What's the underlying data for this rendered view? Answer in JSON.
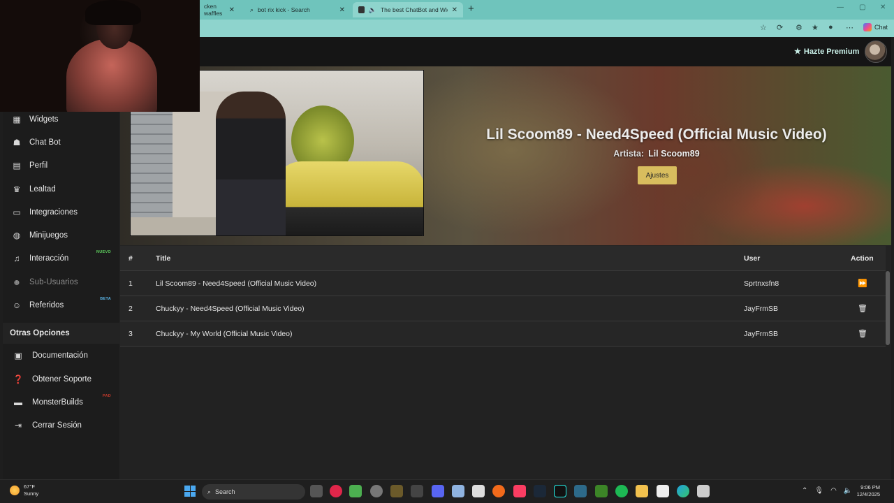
{
  "browser": {
    "tabs": [
      {
        "label": "cken waffles"
      },
      {
        "label": "bot rix kick - Search"
      },
      {
        "label": "The best ChatBot and Widge"
      }
    ],
    "new_tab": "+",
    "chat_label": "Chat"
  },
  "header": {
    "premium_label": "Hazte Premium"
  },
  "sidebar": {
    "items": [
      {
        "label": "Widgets",
        "icon": "widgets-icon"
      },
      {
        "label": "Chat Bot",
        "icon": "robot-icon"
      },
      {
        "label": "Perfil",
        "icon": "id-card-icon"
      },
      {
        "label": "Lealtad",
        "icon": "trophy-icon"
      },
      {
        "label": "Integraciones",
        "icon": "server-icon"
      },
      {
        "label": "Minijuegos",
        "icon": "gamepad-icon"
      },
      {
        "label": "Interacción",
        "icon": "music-icon",
        "badge": "NUEVO"
      },
      {
        "label": "Sub-Usuarios",
        "icon": "users-icon"
      },
      {
        "label": "Referidos",
        "icon": "user-plus-icon",
        "badge": "BETA"
      }
    ],
    "section_title": "Otras Opciones",
    "other_items": [
      {
        "label": "Documentación",
        "icon": "book-icon"
      },
      {
        "label": "Obtener Soporte",
        "icon": "question-icon"
      },
      {
        "label": "MonsterBuilds",
        "icon": "laptop-icon",
        "badge": "PAD"
      },
      {
        "label": "Cerrar Sesión",
        "icon": "logout-icon"
      }
    ],
    "badge_colors": {
      "new": "#5fd35f",
      "beta": "#5ab4e6",
      "pad": "#c0392b"
    }
  },
  "now_playing": {
    "title": "Lil Scoom89 - Need4Speed (Official Music Video)",
    "artist_label": "Artista:",
    "artist": "Lil Scoom89",
    "settings_label": "Ajustes"
  },
  "queue": {
    "headers": {
      "num": "#",
      "title": "Title",
      "user": "User",
      "action": "Action"
    },
    "rows": [
      {
        "num": "1",
        "title": "Lil Scoom89 - Need4Speed (Official Music Video)",
        "user": "Sprtnxsfn8",
        "action": "skip-icon"
      },
      {
        "num": "2",
        "title": "Chuckyy - Need4Speed (Official Music Video)",
        "user": "JayFrmSB",
        "action": "trash-icon"
      },
      {
        "num": "3",
        "title": "Chuckyy - My World (Official Music Video)",
        "user": "JayFrmSB",
        "action": "trash-icon"
      }
    ]
  },
  "taskbar": {
    "weather_temp": "67°F",
    "weather_desc": "Sunny",
    "search_label": "Search",
    "time": "9:06 PM",
    "date": "12/4/2025"
  },
  "colors": {
    "accent_button": "#d8bd5e",
    "browser_chrome": "#8ed4cd",
    "premium_text": "#c9f0e8"
  }
}
